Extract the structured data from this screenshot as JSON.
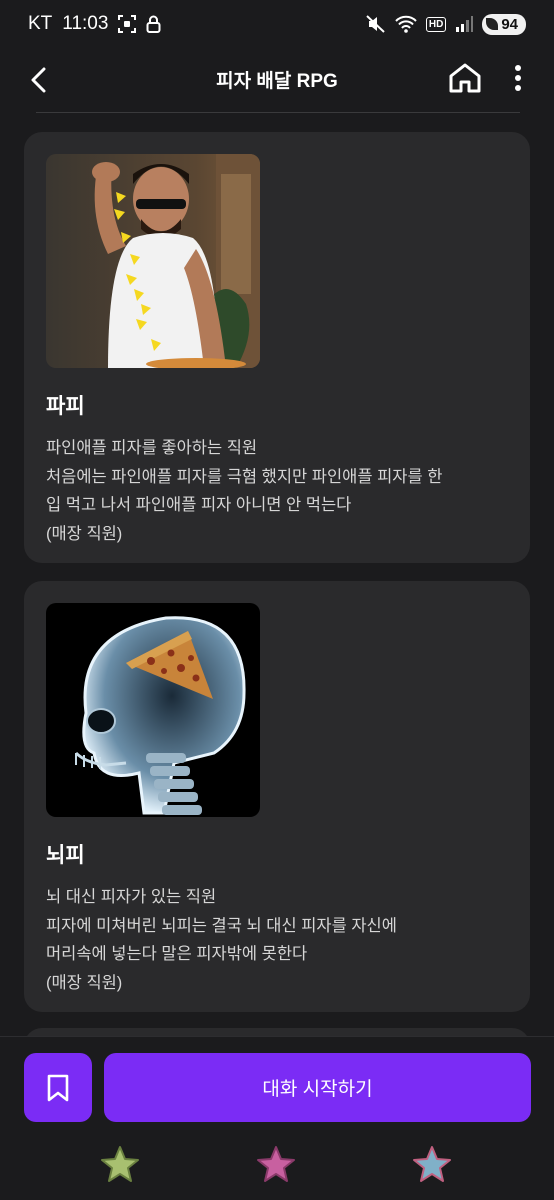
{
  "status_bar": {
    "carrier": "KT",
    "time": "11:03",
    "hd_label": "HD",
    "battery": "94"
  },
  "header": {
    "title": "피자 배달 RPG"
  },
  "characters": [
    {
      "name": "파피",
      "description_lines": [
        "파인애플 피자를 좋아하는 직원",
        "처음에는 파인애플 피자를 극혐 했지만 파인애플 피자를 한",
        "입 먹고 나서 파인애플 피자 아니면 안 먹는다",
        "(매장 직원)"
      ]
    },
    {
      "name": "뇌피",
      "description_lines": [
        "뇌 대신 피자가 있는 직원",
        "피자에 미쳐버린 뇌피는 결국 뇌 대신 피자를 자신에",
        "머리속에 넣는다 말은 피자밖에 못한다",
        "(매장 직원)"
      ]
    }
  ],
  "bottom_bar": {
    "start_label": "대화 시작하기"
  },
  "colors": {
    "accent": "#7b2cf5",
    "card_bg": "#2a2a2c",
    "page_bg": "#1b1b1d",
    "star_green": "#a8c070",
    "star_pink": "#c860a0",
    "star_blue": "#80b0c8"
  }
}
